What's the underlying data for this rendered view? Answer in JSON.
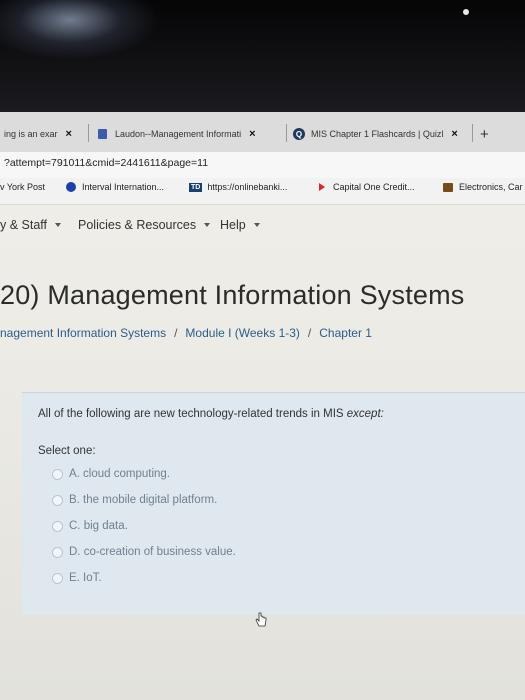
{
  "tabs": [
    {
      "label": "ing is an exar",
      "close": "×"
    },
    {
      "label": "Laudon--Management Informati",
      "close": "×"
    },
    {
      "label": "MIS Chapter 1 Flashcards | Quizl",
      "close": "×"
    }
  ],
  "new_tab": "+",
  "url": "?attempt=791011&cmid=2441611&page=11",
  "bookmarks": [
    {
      "label": "v York Post"
    },
    {
      "label": "Interval Internation..."
    },
    {
      "label": "https://onlinebanki...",
      "badge": "TD"
    },
    {
      "label": "Capital One Credit..."
    },
    {
      "label": "Electronics, Car"
    }
  ],
  "site_nav": [
    {
      "label": "y & Staff"
    },
    {
      "label": "Policies & Resources"
    },
    {
      "label": "Help"
    }
  ],
  "page_title": "20) Management Information Systems",
  "breadcrumb": {
    "items": [
      "nagement Information Systems",
      "Module I (Weeks 1-3)",
      "Chapter 1"
    ],
    "separator": "/"
  },
  "question": {
    "text": "All of the following are new technology-related trends in MIS",
    "emphasis": "except:",
    "prompt": "Select one:",
    "options": [
      "A. cloud computing.",
      "B. the mobile digital platform.",
      "C. big data.",
      "D. co-creation of business value.",
      "E. IoT."
    ]
  },
  "colors": {
    "link": "#2c5c8c",
    "question_bg": "#dfe8ee",
    "bezel": "#0c0c0e"
  }
}
